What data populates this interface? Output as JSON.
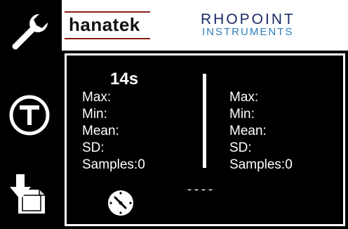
{
  "sidebar": {
    "settings_icon": "wrench-icon",
    "tare_icon": "tare-t-icon",
    "export_icon": "download-file-icon"
  },
  "header": {
    "brand_left": "hanatek",
    "brand_right_line1": "RHOPOINT",
    "brand_right_line2": "INSTRUMENTS"
  },
  "measurement": {
    "timer": "14s",
    "left": {
      "max": "Max:",
      "min": "Min:",
      "mean": "Mean:",
      "sd": "SD:",
      "samples": "Samples:0"
    },
    "right": {
      "max": "Max:",
      "min": "Min:",
      "mean": "Mean:",
      "sd": "SD:",
      "samples": "Samples:0"
    },
    "reading": "----",
    "clock_icon": "clock-icon"
  },
  "colors": {
    "background": "#000000",
    "header": "#ffffff",
    "hanatek_line": "#8a1d17",
    "rhopoint_dark": "#1b2a66",
    "rhopoint_light": "#2d7dbb"
  }
}
